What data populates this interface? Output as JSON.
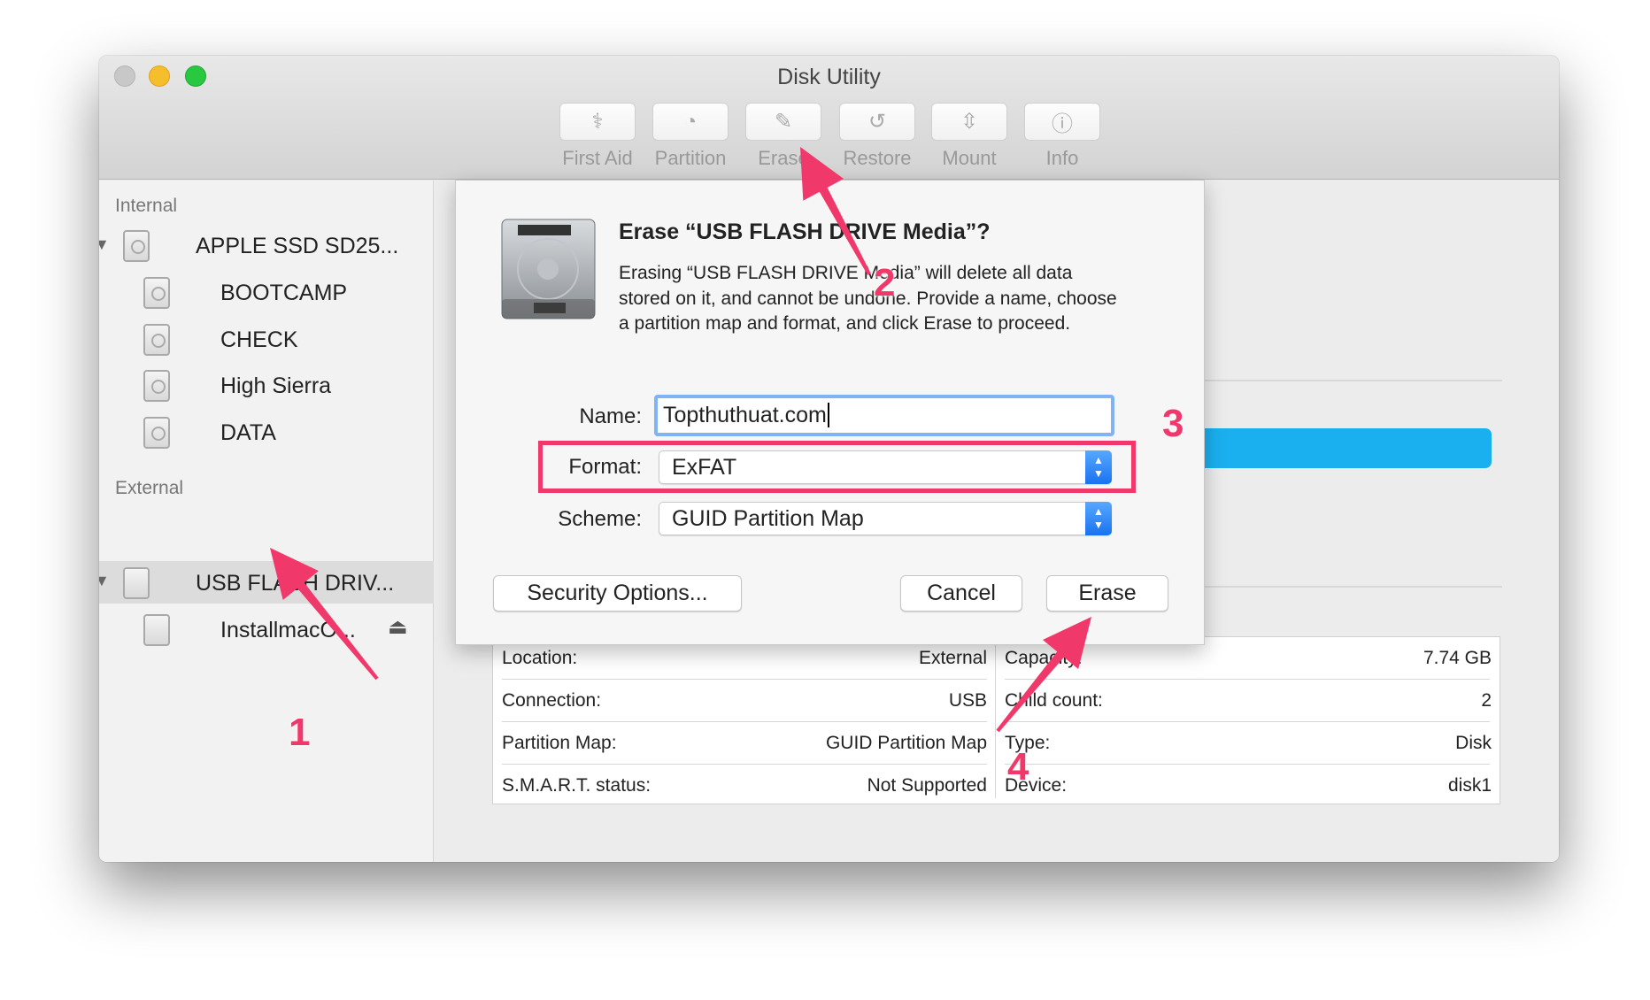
{
  "window": {
    "title": "Disk Utility",
    "traffic_lights": {
      "close": "#c8c8c8",
      "minimize": "#f5bf2c",
      "zoom": "#28c840"
    }
  },
  "toolbar": [
    {
      "label": "First Aid",
      "icon": "stethoscope-icon",
      "glyph": "⚕"
    },
    {
      "label": "Partition",
      "icon": "pie-icon",
      "glyph": "◔"
    },
    {
      "label": "Erase",
      "icon": "erase-icon",
      "glyph": "✎"
    },
    {
      "label": "Restore",
      "icon": "restore-icon",
      "glyph": "↺"
    },
    {
      "label": "Mount",
      "icon": "mount-icon",
      "glyph": "⇳"
    },
    {
      "label": "Info",
      "icon": "info-icon",
      "glyph": "ⓘ"
    }
  ],
  "sidebar": {
    "internal_label": "Internal",
    "internal": [
      {
        "label": "APPLE SSD SD25..."
      },
      {
        "label": "BOOTCAMP"
      },
      {
        "label": "CHECK"
      },
      {
        "label": "High Sierra"
      },
      {
        "label": "DATA"
      }
    ],
    "external_label": "External",
    "external": [
      {
        "label": "USB FLASH DRIV...",
        "selected": true
      },
      {
        "label": "InstallmacO..."
      }
    ],
    "eject_glyph": "⏏"
  },
  "dialog": {
    "title": "Erase “USB FLASH DRIVE Media”?",
    "message": "Erasing “USB FLASH DRIVE Media” will delete all data stored on it, and cannot be undone. Provide a name, choose a partition map and format, and click Erase to proceed.",
    "name_label": "Name:",
    "name_value": "Topthuthuat.com",
    "format_label": "Format:",
    "format_value": "ExFAT",
    "scheme_label": "Scheme:",
    "scheme_value": "GUID Partition Map",
    "security_button": "Security Options...",
    "cancel_button": "Cancel",
    "erase_button": "Erase"
  },
  "info": {
    "left": [
      {
        "k": "Location:",
        "v": "External"
      },
      {
        "k": "Connection:",
        "v": "USB"
      },
      {
        "k": "Partition Map:",
        "v": "GUID Partition Map"
      },
      {
        "k": "S.M.A.R.T. status:",
        "v": "Not Supported"
      }
    ],
    "right": [
      {
        "k": "Capacity:",
        "v": "7.74 GB"
      },
      {
        "k": "Child count:",
        "v": "2"
      },
      {
        "k": "Type:",
        "v": "Disk"
      },
      {
        "k": "Device:",
        "v": "disk1"
      }
    ]
  },
  "annotations": {
    "n1": "1",
    "n2": "2",
    "n3": "3",
    "n4": "4",
    "color": "#f0386b"
  },
  "usage_bar_color": "#1ab0f0"
}
